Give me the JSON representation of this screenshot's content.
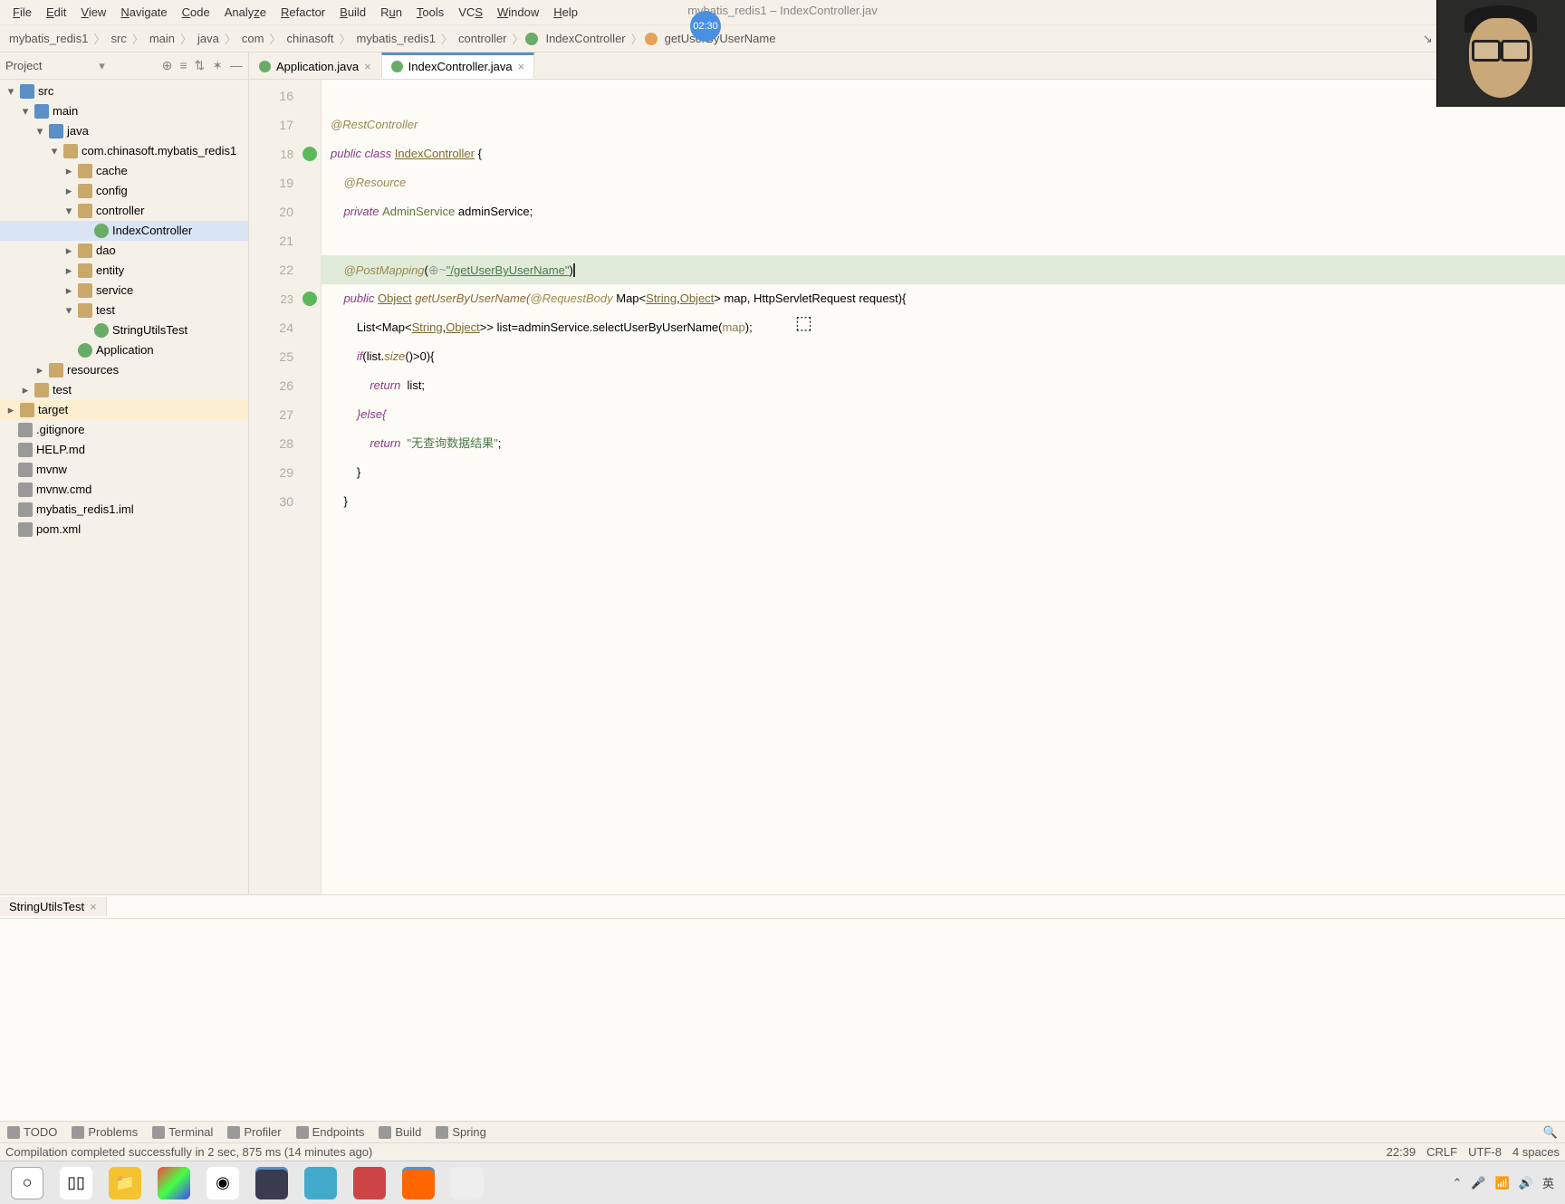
{
  "menu": [
    "File",
    "Edit",
    "View",
    "Navigate",
    "Code",
    "Analyze",
    "Refactor",
    "Build",
    "Run",
    "Tools",
    "VCS",
    "Window",
    "Help"
  ],
  "title": "mybatis_redis1 – IndexController.jav",
  "timer": "02:30",
  "breadcrumbs": [
    "mybatis_redis1",
    "src",
    "main",
    "java",
    "com",
    "chinasoft",
    "mybatis_redis1",
    "controller",
    "IndexController",
    "getUserByUserName"
  ],
  "runconfig": "StringUtilsTest",
  "side_header": "Project",
  "tree": {
    "src": "src",
    "main": "main",
    "java": "java",
    "pkg": "com.chinasoft.mybatis_redis1",
    "cache": "cache",
    "config": "config",
    "controller": "controller",
    "indexctrl": "IndexController",
    "dao": "dao",
    "entity": "entity",
    "service": "service",
    "test": "test",
    "stringutils": "StringUtilsTest",
    "application": "Application",
    "resources": "resources",
    "testfolder": "test",
    "target": "target",
    "gitignore": ".gitignore",
    "help": "HELP.md",
    "mvnw": "mvnw",
    "mvnwcmd": "mvnw.cmd",
    "iml": "mybatis_redis1.iml",
    "pom": "pom.xml"
  },
  "tabs": [
    {
      "label": "Application.java",
      "active": false
    },
    {
      "label": "IndexController.java",
      "active": true
    }
  ],
  "gutter_lines": [
    "16",
    "17",
    "18",
    "19",
    "20",
    "21",
    "22",
    "23",
    "24",
    "25",
    "26",
    "27",
    "28",
    "29",
    "30"
  ],
  "code": {
    "l17_anno": "@RestController",
    "l18_kw1": "public class ",
    "l18_class": "IndexController",
    "l18_brace": " {",
    "l19_anno": "@Resource",
    "l20_kw": "private ",
    "l20_type": "AdminService",
    "l20_rest": " adminService;",
    "l22_anno": "@PostMapping",
    "l22_open": "(",
    "l22_hint": "⊕~",
    "l22_str": "\"/getUserByUserName\"",
    "l22_close": ")",
    "l23_kw": "public ",
    "l23_ret": "Object",
    "l23_fn": " getUserByUserName(",
    "l23_anno": "@RequestBody",
    "l23_map": " Map<",
    "l23_s": "String",
    "l23_c": ",",
    "l23_o": "Object",
    "l23_mapend": "> map, HttpServletRequest request){",
    "l24_list": "List<Map<",
    "l24_s": "String",
    "l24_c": ",",
    "l24_o": "Object",
    "l24_rest": ">> list=adminService.selectUserByUserName(",
    "l24_param": "map",
    "l24_end": ");",
    "l25_if": "if",
    "l25_cond": "(list.",
    "l25_size": "size",
    "l25_rest": "()>0){",
    "l26_ret": "return",
    "l26_val": "  list;",
    "l27_else": "}else{",
    "l28_ret": "return",
    "l28_sp": "  ",
    "l28_str": "\"无查询数据结果\"",
    "l28_semi": ";",
    "l29_brace": "}",
    "l30_brace": "}"
  },
  "runpanel_tab": "StringUtilsTest",
  "toolwindows": [
    "TODO",
    "Problems",
    "Terminal",
    "Profiler",
    "Endpoints",
    "Build",
    "Spring"
  ],
  "status_left": "Compilation completed successfully in 2 sec, 875 ms (14 minutes ago)",
  "status_right": [
    "22:39",
    "CRLF",
    "UTF-8",
    "4 spaces"
  ],
  "tray": {
    "ime": "英"
  }
}
